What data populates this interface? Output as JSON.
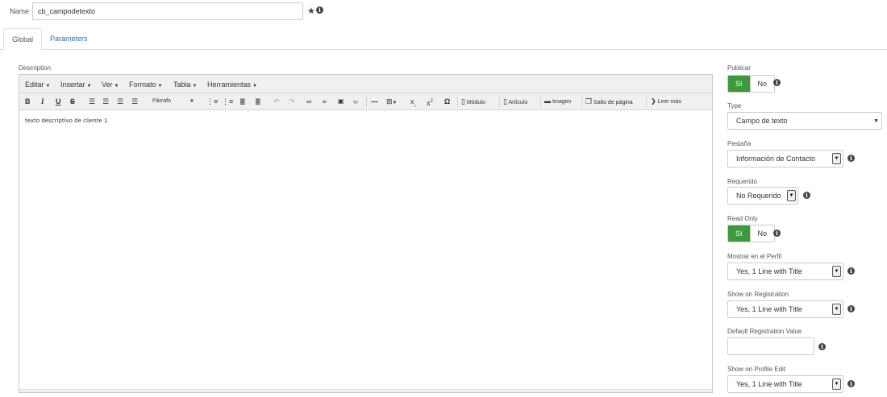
{
  "name": {
    "label": "Name",
    "value": "cb_campodetexto"
  },
  "tabs": [
    {
      "label": "Global",
      "active": true
    },
    {
      "label": "Parameters",
      "active": false
    }
  ],
  "description": {
    "label": "Description",
    "menubar": [
      "Editar",
      "Insertar",
      "Ver",
      "Formato",
      "Tabla",
      "Herramientas"
    ],
    "toolbar": {
      "format_select": "Párrafo",
      "modulo": "Módulo",
      "articulo": "Artículo",
      "imagen": "Imagen",
      "salto": "Salto de página",
      "leer_mas": "Leer más"
    },
    "content": "texto descriptivo de cliente 1"
  },
  "right": {
    "publicar": {
      "label": "Publicar",
      "on": "Sí",
      "off": "No",
      "selected": "Sí"
    },
    "type": {
      "label": "Type",
      "value": "Campo de texto"
    },
    "pestana": {
      "label": "Pestaña",
      "value": "Información de Contacto"
    },
    "requerido": {
      "label": "Requerido",
      "value": "No Requerido"
    },
    "read_only": {
      "label": "Read Only",
      "on": "Sí",
      "off": "No",
      "selected": "Sí"
    },
    "mostrar_perfil": {
      "label": "Mostrar en el Perfil",
      "value": "Yes, 1 Line with Title"
    },
    "show_registration": {
      "label": "Show on Registration",
      "value": "Yes, 1 Line with Title"
    },
    "default_registration": {
      "label": "Default Registration Value",
      "value": ""
    },
    "show_profile_edit": {
      "label": "Show on Profile Edit",
      "value": "Yes, 1 Line with Title"
    }
  },
  "colors": {
    "accent_green": "#3b9b3b",
    "link_blue": "#2a6ebb"
  },
  "icons": [
    "star-icon",
    "info-icon",
    "caret-down-icon",
    "bold-icon",
    "italic-icon",
    "underline-icon",
    "strikethrough-icon",
    "align-left-icon",
    "align-center-icon",
    "align-right-icon",
    "align-justify-icon",
    "bullet-list-icon",
    "numbered-list-icon",
    "outdent-icon",
    "indent-icon",
    "undo-icon",
    "redo-icon",
    "link-icon",
    "unlink-icon",
    "image-icon",
    "code-icon",
    "horizontal-rule-icon",
    "table-icon",
    "subscript-icon",
    "superscript-icon",
    "omega-icon",
    "document-icon",
    "checkmark-icon"
  ]
}
